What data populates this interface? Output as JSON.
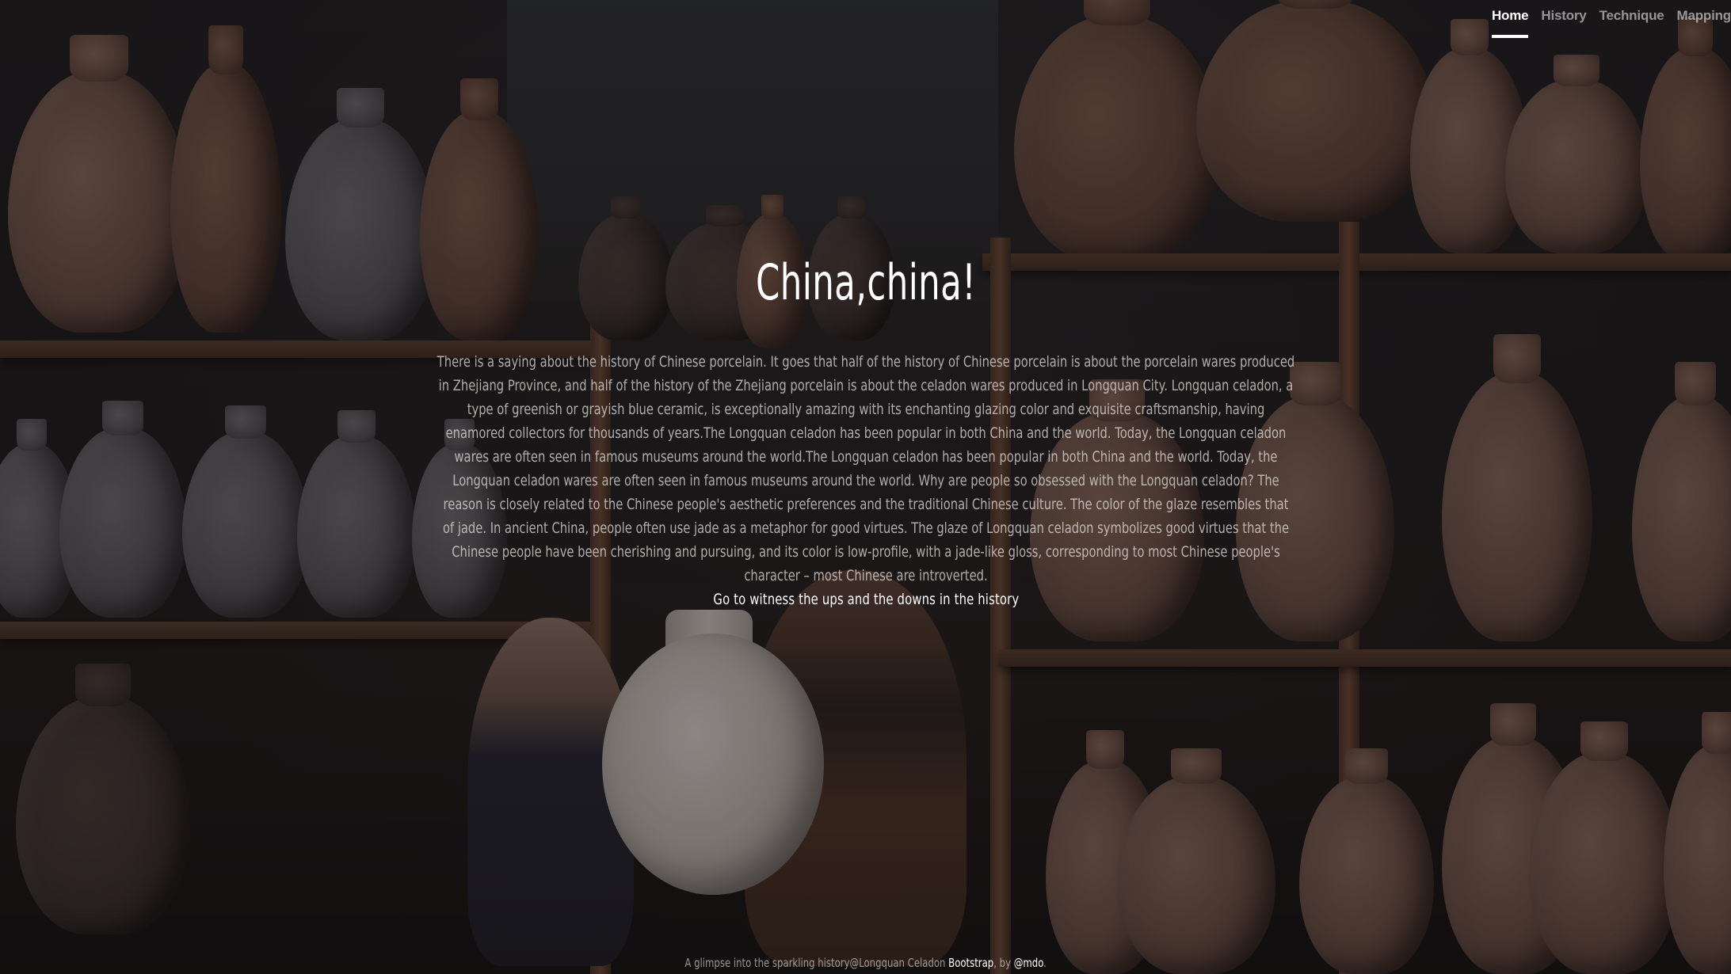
{
  "nav": {
    "items": [
      {
        "label": "Home",
        "active": true
      },
      {
        "label": "History",
        "active": false
      },
      {
        "label": "Technique",
        "active": false
      },
      {
        "label": "Mapping",
        "active": false
      }
    ]
  },
  "hero": {
    "title": "China,china!",
    "paragraph": "There is a saying about the history of Chinese porcelain. It goes that half of the history of Chinese porcelain is about the porcelain wares produced in Zhejiang Province, and half of the history of the Zhejiang porcelain is about the celadon wares produced in Longquan City. Longquan celadon, a type of greenish or grayish blue ceramic, is exceptionally amazing with its enchanting glazing color and exquisite craftsmanship, having enamored collectors for thousands of years.The Longquan celadon has been popular in both China and the world. Today, the Longquan celadon wares are often seen in famous museums around the world.The Longquan celadon has been popular in both China and the world. Today, the Longquan celadon wares are often seen in famous museums around the world. Why are people so obsessed with the Longquan celadon? The reason is closely related to the Chinese people's aesthetic preferences and the traditional Chinese culture. The color of the glaze resembles that of jade. In ancient China, people often use jade as a metaphor for good virtues. The glaze of Longquan celadon symbolizes good virtues that the Chinese people have been cherishing and pursuing, and its color is low-profile, with a jade-like gloss, corresponding to most Chinese people's character – most Chinese are introverted.",
    "cta_label": "Go to witness the ups and the downs in the history"
  },
  "footer": {
    "prefix": "A glimpse into the sparkling history@Longquan Celadon ",
    "link1": "Bootstrap",
    "middle": ", by ",
    "link2": "@mdo",
    "suffix": "."
  },
  "colors": {
    "overlay": "#0c0b0c",
    "text_primary": "#ffffff",
    "text_muted": "#e8e4e2"
  }
}
